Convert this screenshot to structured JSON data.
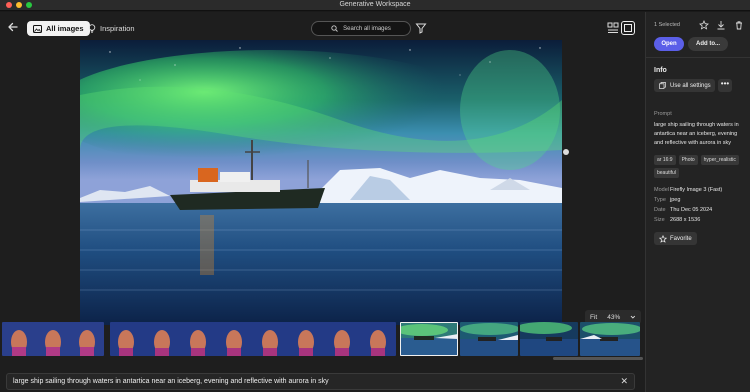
{
  "window": {
    "title": "Generative Workspace"
  },
  "toolbar": {
    "back_icon": "arrow-left-icon",
    "tabs": [
      {
        "label": "All images",
        "icon": "image-icon",
        "active": true
      },
      {
        "label": "Inspiration",
        "icon": "lightbulb-icon",
        "active": false
      }
    ],
    "search_placeholder": "Search all images",
    "filter_icon": "filter-icon",
    "layout_icon": "layout-icon",
    "view_icon": "single-view-icon"
  },
  "viewer": {
    "zoom_mode": "Fit",
    "zoom_level": "43%"
  },
  "prompt_bar": {
    "text": "large ship sailing through waters in antartica near an iceberg, evening and reflective with aurora in sky",
    "close_icon": "close-icon"
  },
  "panel": {
    "selected_count": "1 Selected",
    "open_label": "Open",
    "add_label": "Add to...",
    "info_heading": "Info",
    "use_settings_label": "Use all settings",
    "prompt_heading": "Prompt",
    "prompt_text": "large ship sailing through waters in antartica near an iceberg, evening and reflective with aurora in sky",
    "tags": [
      "ar 16:9",
      "Photo",
      "hyper_realistic",
      "beautiful"
    ],
    "details": [
      {
        "key": "Model",
        "value": "Firefly Image 3 (Fast)"
      },
      {
        "key": "Type",
        "value": "jpeg"
      },
      {
        "key": "Date",
        "value": "Thu Dec 05 2024"
      },
      {
        "key": "Size",
        "value": "2688 x 1536"
      }
    ],
    "favorite_label": "Favorite"
  },
  "colors": {
    "accent": "#5b5fe8",
    "background": "#1e1e1e",
    "panel": "#232323"
  }
}
